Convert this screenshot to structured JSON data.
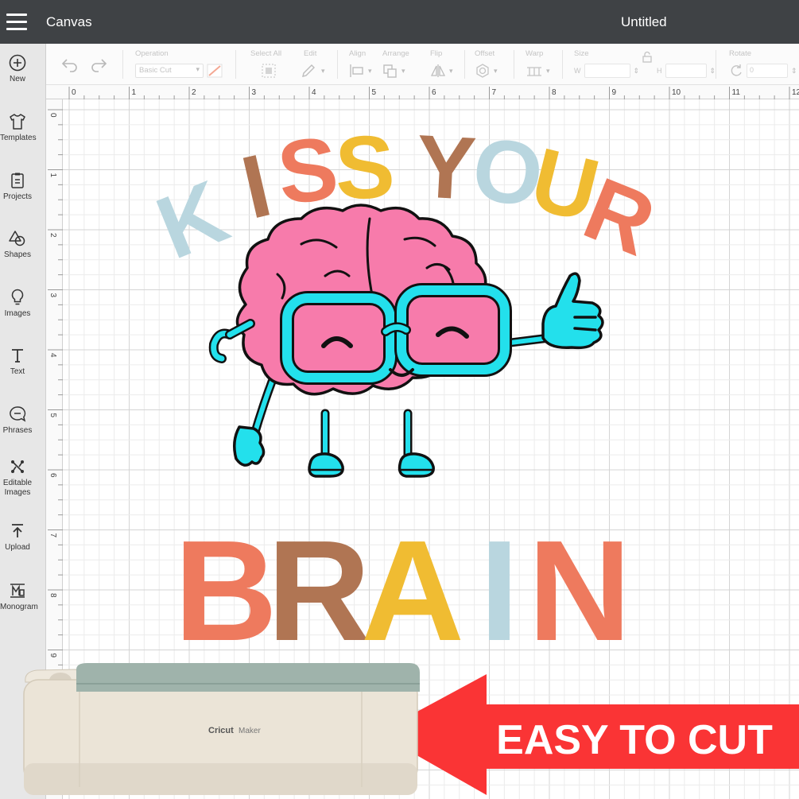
{
  "topbar": {
    "app_name": "Canvas",
    "document_title": "Untitled"
  },
  "sidebar": {
    "items": [
      {
        "label": "New",
        "icon": "plus-circle-icon"
      },
      {
        "label": "Templates",
        "icon": "tshirt-icon"
      },
      {
        "label": "Projects",
        "icon": "clipboard-icon"
      },
      {
        "label": "Shapes",
        "icon": "shapes-icon"
      },
      {
        "label": "Images",
        "icon": "lightbulb-icon"
      },
      {
        "label": "Text",
        "icon": "text-icon"
      },
      {
        "label": "Phrases",
        "icon": "speech-bubble-icon"
      },
      {
        "label": "Editable Images",
        "icon": "editable-image-icon"
      },
      {
        "label": "Upload",
        "icon": "upload-icon"
      },
      {
        "label": "Monogram",
        "icon": "monogram-icon"
      }
    ]
  },
  "toolbar": {
    "operation_label": "Operation",
    "operation_value": "Basic Cut",
    "select_all_label": "Select All",
    "edit_label": "Edit",
    "align_label": "Align",
    "arrange_label": "Arrange",
    "flip_label": "Flip",
    "offset_label": "Offset",
    "warp_label": "Warp",
    "size_label": "Size",
    "width_prefix": "W",
    "height_prefix": "H",
    "rotate_label": "Rotate",
    "rotate_value": "0"
  },
  "ruler": {
    "top_numbers": [
      "0",
      "1",
      "2",
      "3",
      "4",
      "5",
      "6",
      "7",
      "8",
      "9",
      "10",
      "11",
      "12"
    ],
    "left_numbers": [
      "0",
      "1",
      "2",
      "3",
      "4",
      "5",
      "6",
      "7",
      "8",
      "9"
    ]
  },
  "design": {
    "headline_top": [
      "K",
      "I",
      "S",
      "S",
      "Y",
      "O",
      "U",
      "R"
    ],
    "headline_bottom": [
      "B",
      "R",
      "A",
      "I",
      "N"
    ]
  },
  "promo": {
    "machine_brand": "Cricut",
    "machine_model": "Maker",
    "banner_text": "EASY TO CUT"
  },
  "colors": {
    "topbar_bg": "#3f4245",
    "sidebar_bg": "#e7e7e7",
    "grid_minor": "#ececec",
    "grid_major": "#d4d4d4",
    "letter_blue": "#b9d6df",
    "letter_brown": "#b07553",
    "letter_coral": "#ee7a5e",
    "letter_yellow": "#f0bc32",
    "brain_pink": "#f77bab",
    "brain_cyan": "#23e0ec",
    "banner_red": "#fa3435",
    "machine_body": "#ebe4d7",
    "machine_lid": "#9fb3ab"
  }
}
